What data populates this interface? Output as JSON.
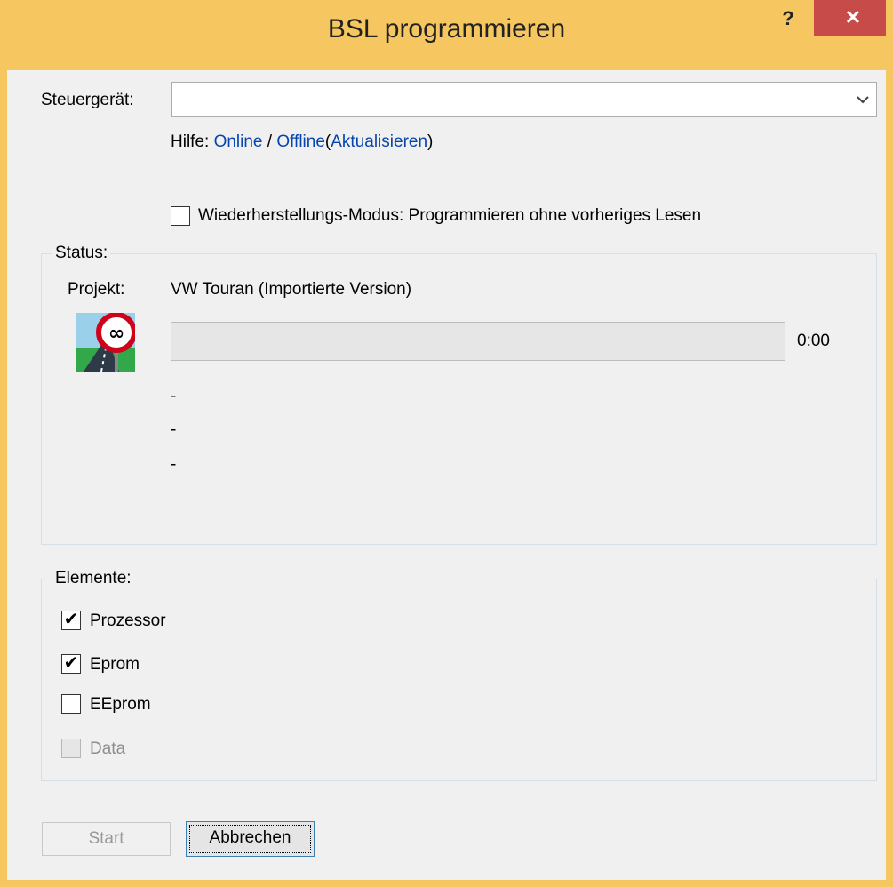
{
  "window": {
    "title": "BSL programmieren",
    "help_glyph": "?",
    "close_glyph": "✕"
  },
  "steuergeraet": {
    "label": "Steuergerät:",
    "value": "",
    "arrow_glyph": "⌄"
  },
  "help": {
    "prefix": "Hilfe:",
    "online": "Online",
    "separator": "/",
    "offline": "Offline",
    "open_paren": "(",
    "refresh": "Aktualisieren",
    "close_paren": ")"
  },
  "recovery": {
    "label": "Wiederherstellungs-Modus: Programmieren ohne vorheriges Lesen",
    "checked": false
  },
  "status": {
    "group_title": "Status:",
    "project_label": "Projekt:",
    "project_value": "VW Touran (Importierte Version)",
    "time": "0:00",
    "progress": 0,
    "lines": [
      "-",
      "-",
      "-"
    ],
    "icon": "speed-limit-end-icon"
  },
  "elements": {
    "group_title": "Elemente:",
    "items": [
      {
        "label": "Prozessor",
        "checked": true,
        "enabled": true
      },
      {
        "label": "Eprom",
        "checked": true,
        "enabled": true
      },
      {
        "label": "EEprom",
        "checked": false,
        "enabled": true
      },
      {
        "label": "Data",
        "checked": false,
        "enabled": false
      }
    ]
  },
  "buttons": {
    "start": "Start",
    "cancel": "Abbrechen"
  },
  "colors": {
    "title_bar": "#f6c760",
    "close_button": "#c74b48",
    "link": "#0645ad"
  }
}
